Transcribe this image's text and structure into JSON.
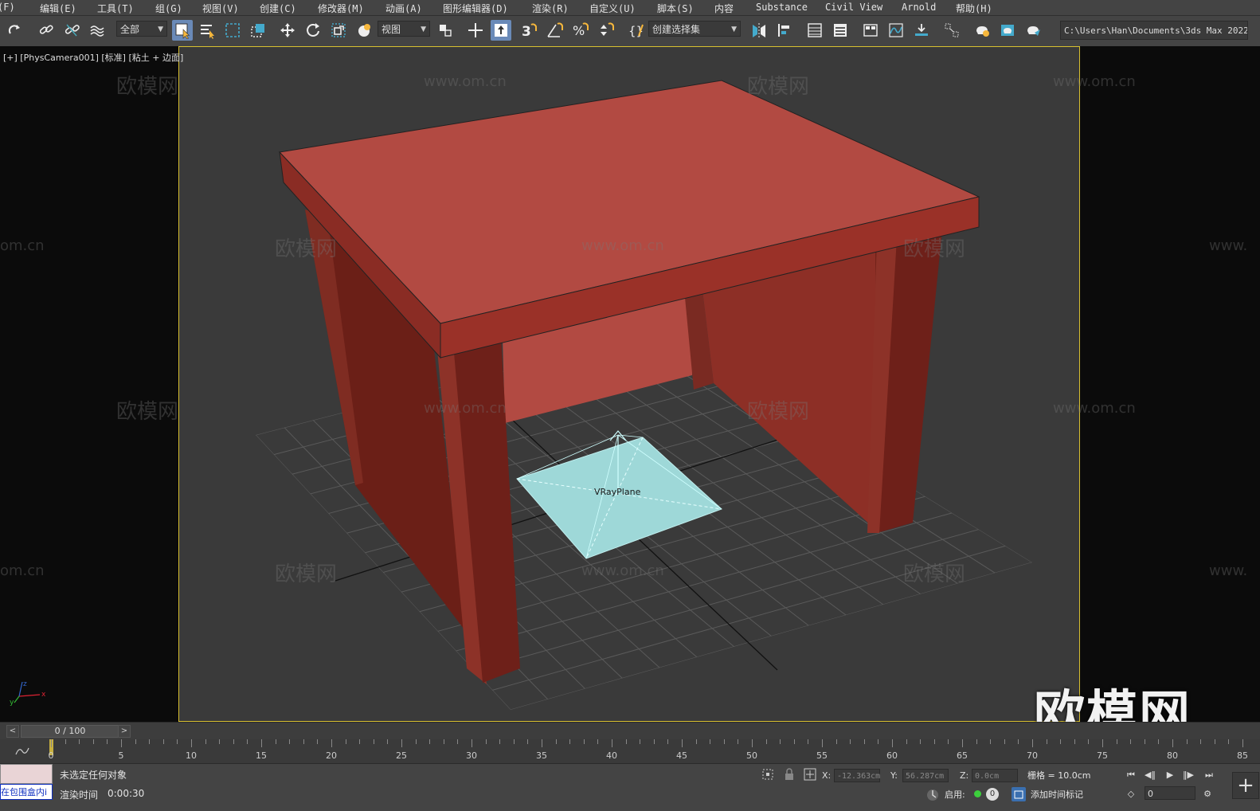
{
  "menu": [
    {
      "id": "file",
      "label": "(F)"
    },
    {
      "id": "edit",
      "label": "编辑(E)"
    },
    {
      "id": "tools",
      "label": "工具(T)"
    },
    {
      "id": "group",
      "label": "组(G)"
    },
    {
      "id": "views",
      "label": "视图(V)"
    },
    {
      "id": "create",
      "label": "创建(C)"
    },
    {
      "id": "modifiers",
      "label": "修改器(M)"
    },
    {
      "id": "animation",
      "label": "动画(A)"
    },
    {
      "id": "graph-editors",
      "label": "图形编辑器(D)"
    },
    {
      "id": "rendering",
      "label": "渲染(R)"
    },
    {
      "id": "customize",
      "label": "自定义(U)"
    },
    {
      "id": "scripting",
      "label": "脚本(S)"
    },
    {
      "id": "content",
      "label": "内容"
    },
    {
      "id": "substance",
      "label": "Substance"
    },
    {
      "id": "civil-view",
      "label": "Civil View"
    },
    {
      "id": "arnold",
      "label": "Arnold"
    },
    {
      "id": "help",
      "label": "帮助(H)"
    }
  ],
  "toolbar": {
    "selection_filter": "全部",
    "reference_coord": "视图",
    "named_selection": "创建选择集",
    "project_path": "C:\\Users\\Han\\Documents\\3ds Max 2022"
  },
  "viewport": {
    "label": "[+] [PhysCamera001] [标准] [粘土 + 边面]",
    "object_label": "VRayPlane"
  },
  "watermarks": {
    "brand": "欧模网",
    "url": "www.om.cn",
    "url_short": "om.cn",
    "url_cut": "www."
  },
  "gizmo": {
    "x": "x",
    "y": "y",
    "z": "z"
  },
  "timeslider": {
    "frame_display": "0 / 100",
    "prev": "<",
    "next": ">"
  },
  "trackbar": {
    "labels": [
      "0",
      "5",
      "10",
      "15",
      "20",
      "25",
      "30",
      "35",
      "40",
      "45",
      "50",
      "55",
      "60",
      "65",
      "70",
      "75",
      "80",
      "85"
    ]
  },
  "status": {
    "selection_msg": "未选定任何对象",
    "render_time_label": "渲染时间",
    "render_time_value": "0:00:30",
    "mini_link": "在包围盒内i",
    "x_label": "X:",
    "x_value": "-12.363cm",
    "y_label": "Y:",
    "y_value": "56.287cm",
    "z_label": "Z:",
    "z_value": "0.0cm",
    "grid_label": "栅格 = 10.0cm",
    "enabled_label": "启用:",
    "enabled_count": "0",
    "add_time_tag": "添加时间标记",
    "frame_value": "0"
  },
  "colors": {
    "table": "#b24a42",
    "table_dark": "#7a2a22",
    "plane": "#9ed8d8",
    "viewport_border": "#d8c030"
  }
}
